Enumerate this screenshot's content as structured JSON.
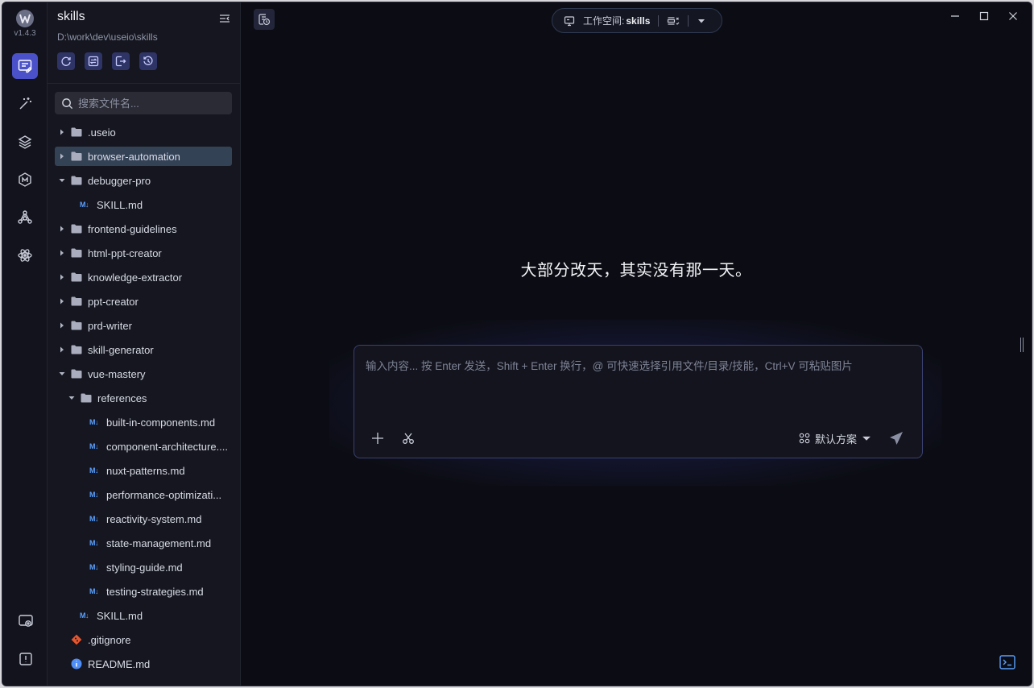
{
  "app": {
    "version": "v1.4.3",
    "accent": "#4b52c9"
  },
  "sidebar": {
    "project_name": "skills",
    "project_path": "D:\\work\\dev\\useio\\skills",
    "search_placeholder": "搜索文件名...",
    "tree": [
      {
        "label": ".useio",
        "type": "folder",
        "depth": 0,
        "expanded": false
      },
      {
        "label": "browser-automation",
        "type": "folder",
        "depth": 0,
        "expanded": false,
        "selected": true
      },
      {
        "label": "debugger-pro",
        "type": "folder",
        "depth": 0,
        "expanded": true
      },
      {
        "label": "SKILL.md",
        "type": "md",
        "depth": 1
      },
      {
        "label": "frontend-guidelines",
        "type": "folder",
        "depth": 0,
        "expanded": false
      },
      {
        "label": "html-ppt-creator",
        "type": "folder",
        "depth": 0,
        "expanded": false
      },
      {
        "label": "knowledge-extractor",
        "type": "folder",
        "depth": 0,
        "expanded": false
      },
      {
        "label": "ppt-creator",
        "type": "folder",
        "depth": 0,
        "expanded": false
      },
      {
        "label": "prd-writer",
        "type": "folder",
        "depth": 0,
        "expanded": false
      },
      {
        "label": "skill-generator",
        "type": "folder",
        "depth": 0,
        "expanded": false
      },
      {
        "label": "vue-mastery",
        "type": "folder",
        "depth": 0,
        "expanded": true
      },
      {
        "label": "references",
        "type": "folder",
        "depth": 1,
        "expanded": true
      },
      {
        "label": "built-in-components.md",
        "type": "md",
        "depth": 2
      },
      {
        "label": "component-architecture....",
        "type": "md",
        "depth": 2
      },
      {
        "label": "nuxt-patterns.md",
        "type": "md",
        "depth": 2
      },
      {
        "label": "performance-optimizati...",
        "type": "md",
        "depth": 2
      },
      {
        "label": "reactivity-system.md",
        "type": "md",
        "depth": 2
      },
      {
        "label": "state-management.md",
        "type": "md",
        "depth": 2
      },
      {
        "label": "styling-guide.md",
        "type": "md",
        "depth": 2
      },
      {
        "label": "testing-strategies.md",
        "type": "md",
        "depth": 2
      },
      {
        "label": "SKILL.md",
        "type": "md",
        "depth": 1
      },
      {
        "label": ".gitignore",
        "type": "git",
        "depth": 0
      },
      {
        "label": "README.md",
        "type": "info",
        "depth": 0
      }
    ]
  },
  "header": {
    "workspace_label": "工作空间:",
    "workspace_name": "skills"
  },
  "main": {
    "quote": "大部分改天，其实没有那一天。",
    "composer_placeholder": "输入内容... 按 Enter 发送，Shift + Enter 换行，@ 可快速选择引用文件/目录/技能，Ctrl+V 可粘贴图片",
    "plan_label": "默认方案"
  }
}
